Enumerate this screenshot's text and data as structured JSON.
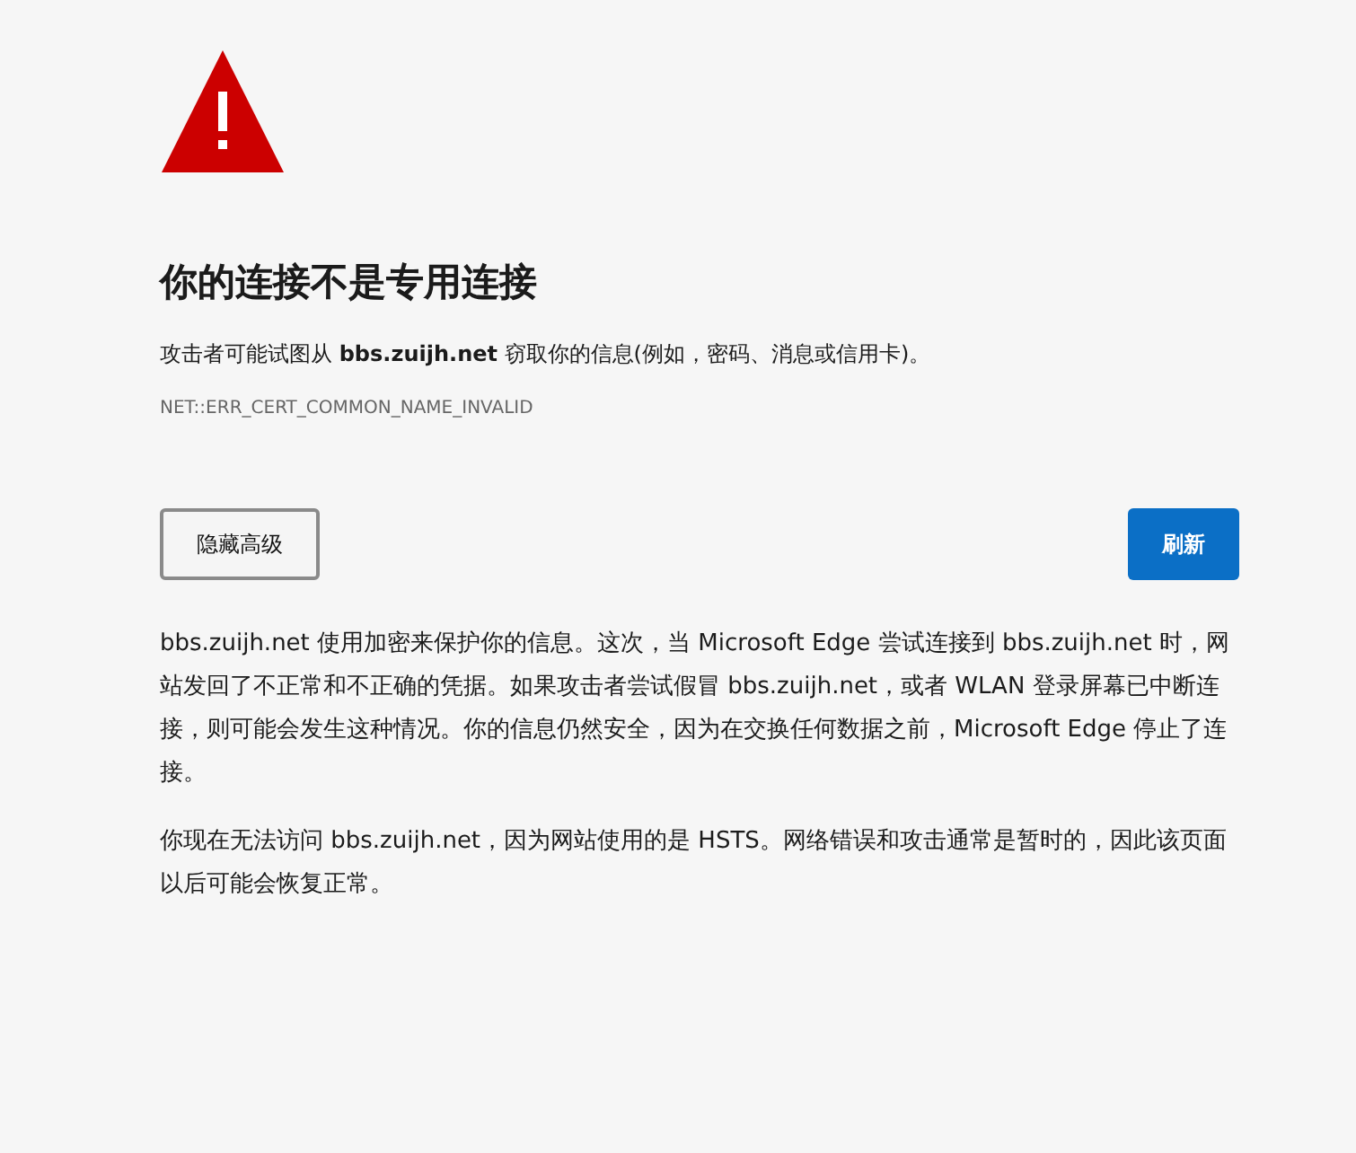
{
  "heading": "你的连接不是专用连接",
  "summary": "攻击者可能试图从 **bbs.zuijh.net** 窃取你的信息(例如，密码、消息或信用卡)。",
  "error_code": "NET::ERR_CERT_COMMON_NAME_INVALID",
  "buttons": [
    {
      "label": "隐藏高级",
      "kind": "secondary"
    },
    {
      "label": "刷新",
      "kind": "primary"
    }
  ],
  "details": [
    "bbs.zuijh.net 使用加密来保护你的信息。这次，当 Microsoft Edge 尝试连接到 bbs.zuijh.net 时，网站发回了不正常和不正确的凭据。如果攻击者尝试假冒 bbs.zuijh.net，或者 WLAN 登录屏幕已中断连接，则可能会发生这种情况。你的信息仍然安全，因为在交换任何数据之前，Microsoft Edge 停止了连接。",
    "你现在无法访问 bbs.zuijh.net，因为网站使用的是 HSTS。网络错误和攻击通常是暂时的，因此该页面以后可能会恢复正常。"
  ]
}
